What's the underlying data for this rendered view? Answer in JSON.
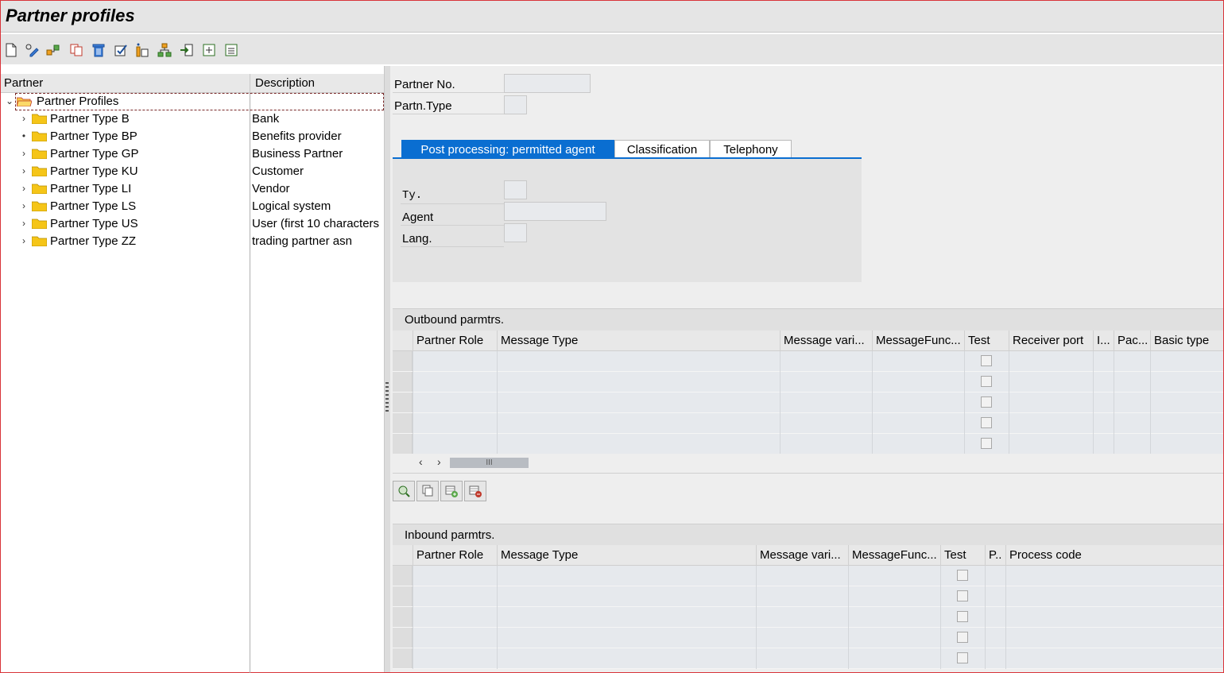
{
  "window": {
    "title": "Partner profiles"
  },
  "toolbar": {
    "icons": [
      "new-document-icon",
      "change-icon",
      "display-icon",
      "copy-icon",
      "delete-icon",
      "check-icon",
      "info-icon",
      "hierarchy-icon",
      "import-icon",
      "expand-icon",
      "collapse-icon"
    ]
  },
  "tree": {
    "headers": {
      "partner": "Partner",
      "description": "Description"
    },
    "root": {
      "label": "Partner Profiles"
    },
    "items": [
      {
        "label": "Partner Type B",
        "desc": "Bank",
        "expander": "›"
      },
      {
        "label": "Partner Type BP",
        "desc": "Benefits provider",
        "expander": "•"
      },
      {
        "label": "Partner Type GP",
        "desc": "Business Partner",
        "expander": "›"
      },
      {
        "label": "Partner Type KU",
        "desc": "Customer",
        "expander": "›"
      },
      {
        "label": "Partner Type LI",
        "desc": "Vendor",
        "expander": "›"
      },
      {
        "label": "Partner Type LS",
        "desc": "Logical system",
        "expander": "›"
      },
      {
        "label": "Partner Type US",
        "desc": "User (first 10 characters",
        "expander": "›"
      },
      {
        "label": "Partner Type ZZ",
        "desc": "trading partner asn",
        "expander": "›"
      }
    ]
  },
  "header_fields": {
    "partner_no_label": "Partner No.",
    "partner_no_value": "",
    "partn_type_label": "Partn.Type",
    "partn_type_value": ""
  },
  "tabs": [
    {
      "label": "Post processing: permitted agent",
      "active": true
    },
    {
      "label": "Classification",
      "active": false
    },
    {
      "label": "Telephony",
      "active": false
    }
  ],
  "agent": {
    "ty_label": "Ty.",
    "agent_label": "Agent",
    "lang_label": "Lang."
  },
  "outbound": {
    "title": "Outbound parmtrs.",
    "columns": [
      "Partner Role",
      "Message Type",
      "Message vari...",
      "MessageFunc...",
      "Test",
      "Receiver port",
      "I...",
      "Pac...",
      "Basic type"
    ],
    "rows": 5,
    "scroll_thumb": "III"
  },
  "inbound": {
    "title": "Inbound parmtrs.",
    "columns": [
      "Partner Role",
      "Message Type",
      "Message vari...",
      "MessageFunc...",
      "Test",
      "P..",
      "Process code"
    ],
    "rows": 5
  },
  "colors": {
    "accent": "#0a6ed1",
    "folder": "#f5c518",
    "frame": "#d9343a"
  }
}
